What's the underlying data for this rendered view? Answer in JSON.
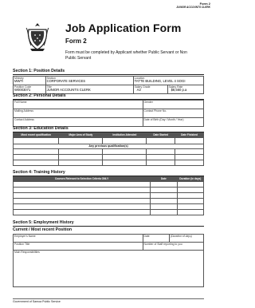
{
  "header": {
    "form_no": "Form 2",
    "sub": "JUNIOR ACCOUNTS CLERK"
  },
  "title": "Job Application Form",
  "subtitle": "Form 2",
  "intro": "Form must be completed by Applicant whether Public Servant or Non Public Servant",
  "section1": {
    "heading": "Section 1: Position Details",
    "ministry_label": "Ministry",
    "ministry": "MWTI",
    "section_label": "Section",
    "section": "CORPORATE SERVICES",
    "location_label": "Location",
    "location": "TATTE BUILDING, LEVEL 4  SOGI",
    "code_label": "Position Code",
    "code": "W0003071",
    "title_label": "Title",
    "title": "JUNIOR ACCOUNTS CLERK",
    "grade_label": "Salary Grade",
    "grade": "A3",
    "rate_label": "Salary Rate",
    "rate": "$8,560 p.a"
  },
  "section2": {
    "heading": "Section 2: Personal Details",
    "full_name": "Full Name",
    "gender": "Gender",
    "mailing": "Mailing Address",
    "phone": "Contact Phone No.",
    "contact": "Contact Address",
    "dob": "Date of Birth (Day / Month / Year)"
  },
  "section3": {
    "heading": "Section 3: Education Details",
    "cols": [
      "Most recent qualification",
      "Major Area of Study",
      "Institution Attended",
      "Date Started",
      "Date Finished"
    ],
    "previous": "Any previous qualification(s)"
  },
  "section4": {
    "heading": "Section 4: Training History",
    "cols": [
      "Courses Relevant to Selection Criteria ONLY",
      "Date",
      "Duration (in days)"
    ]
  },
  "section5": {
    "heading": "Section 5: Employment History",
    "subheading": "Current / Most recent Position",
    "employer": "Employer's Name",
    "date": "Date",
    "duration": "(Duration of days)",
    "position": "Position Title",
    "staff": "Number of Staff reporting to you",
    "responsibilities": "Main Responsibilities"
  },
  "footer": "Government of Samoa Public Service"
}
